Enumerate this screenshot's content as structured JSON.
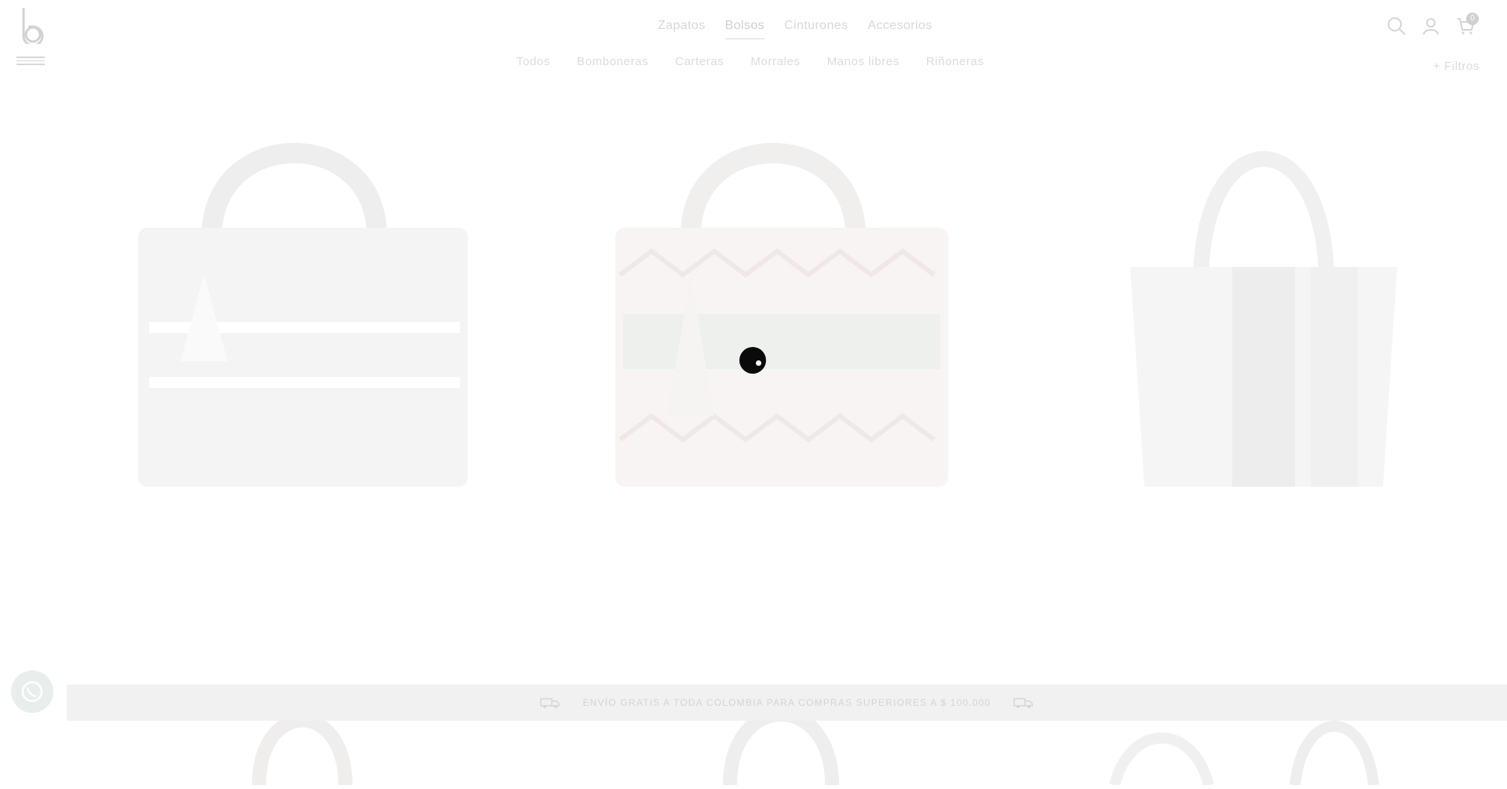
{
  "header": {
    "logo_letter": "b",
    "top_nav": [
      "Zapatos",
      "Bolsos",
      "Cinturones",
      "Accesorios"
    ],
    "active_top": "Bolsos",
    "sub_nav": [
      "Todos",
      "Bomboneras",
      "Carteras",
      "Morrales",
      "Manos libres",
      "Riñoneras"
    ],
    "filters_label": "+ Filtros",
    "cart_count": "0"
  },
  "banner": {
    "shipping_text": "ENVÍO GRATIS A TODA COLOMBIA PARA COMPRAS SUPERIORES A $ 100.000"
  },
  "icons": [
    "logo-icon",
    "menu-icon",
    "search-icon",
    "user-icon",
    "cart-icon",
    "truck-icon",
    "whatsapp-icon",
    "loading-spinner"
  ],
  "colors": {
    "accent": "#0a0a0a",
    "muted_text": "#d8d8d8",
    "banner_bg": "#f1f1f1"
  }
}
